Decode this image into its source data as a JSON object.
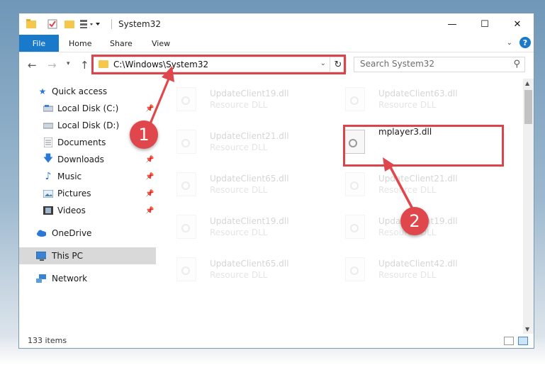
{
  "window": {
    "title": "System32",
    "controls": {
      "minimize": "—",
      "maximize": "☐",
      "close": "✕"
    }
  },
  "ribbon": {
    "tabs": [
      "File",
      "Home",
      "Share",
      "View"
    ],
    "help": "?"
  },
  "address_bar": {
    "path": "C:\\Windows\\System32",
    "search_placeholder": "Search System32"
  },
  "nav_pane": {
    "items": [
      {
        "label": "Quick access",
        "icon": "star-icon"
      },
      {
        "label": "Local Disk (C:)",
        "icon": "drive-icon",
        "pinned": true
      },
      {
        "label": "Local Disk (D:)",
        "icon": "drive-icon"
      },
      {
        "label": "Documents",
        "icon": "documents-icon",
        "pinned": true
      },
      {
        "label": "Downloads",
        "icon": "download-arrow-icon",
        "pinned": true
      },
      {
        "label": "Music",
        "icon": "music-note-icon",
        "pinned": true
      },
      {
        "label": "Pictures",
        "icon": "pictures-icon",
        "pinned": true
      },
      {
        "label": "Videos",
        "icon": "film-icon",
        "pinned": true
      },
      {
        "label": "OneDrive",
        "icon": "cloud-icon"
      },
      {
        "label": "This PC",
        "icon": "monitor-icon",
        "selected": true
      },
      {
        "label": "Network",
        "icon": "network-icon"
      }
    ]
  },
  "files": [
    {
      "name": "UpdateClient19.dll",
      "type": "Resource DLL"
    },
    {
      "name": "UpdateClient63.dll",
      "type": "Resource DLL"
    },
    {
      "name": "UpdateClient21.dll",
      "type": "Resource DLL"
    },
    {
      "name": "mplayer3.dll",
      "type": ""
    },
    {
      "name": "UpdateClient65.dll",
      "type": "Resource DLL"
    },
    {
      "name": "UpdateClient21.dll",
      "type": "Resource DLL"
    },
    {
      "name": "UpdateClient19.dll",
      "type": "Resource DLL"
    },
    {
      "name": "UpdateClient19.dll",
      "type": "Resource DLL"
    },
    {
      "name": "UpdateClient65.dll",
      "type": "Resource DLL"
    },
    {
      "name": "UpdateClient42.dll",
      "type": "Resource DLL"
    }
  ],
  "status": {
    "item_count": "133 items"
  },
  "annotations": {
    "callout_1": "1",
    "callout_2": "2",
    "color": "#e0474c"
  }
}
